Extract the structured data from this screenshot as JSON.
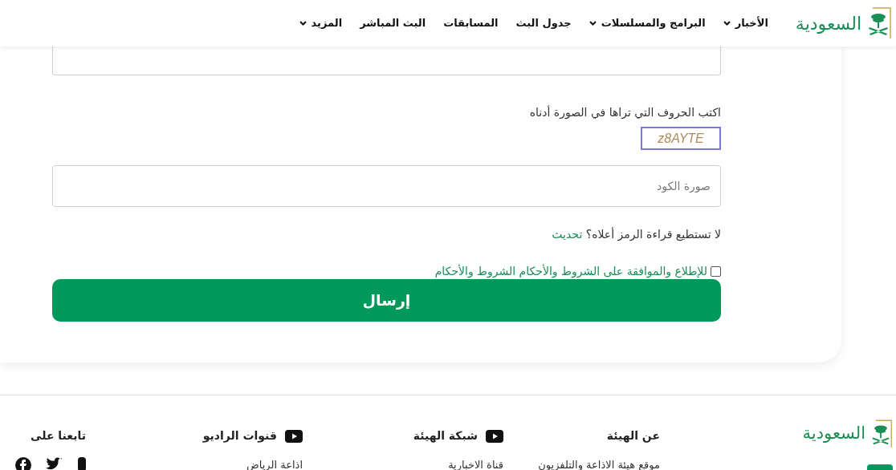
{
  "header": {
    "logo_text": "السعودية",
    "nav": [
      {
        "label": "الأخبار",
        "has_dropdown": true
      },
      {
        "label": "البرامج والمسلسلات",
        "has_dropdown": true
      },
      {
        "label": "جدول البث",
        "has_dropdown": false
      },
      {
        "label": "المسابقات",
        "has_dropdown": false
      },
      {
        "label": "البث المباشر",
        "has_dropdown": false
      },
      {
        "label": "المزيد",
        "has_dropdown": true
      }
    ]
  },
  "form": {
    "captcha_label": "اكتب الحروف التي تراها في الصورة أدناه",
    "captcha_text": "z8AYTE",
    "code_field": {
      "placeholder": "صورة الكود"
    },
    "refresh_prompt": "لا تستطيع قراءة الرمز أعلاه؟",
    "refresh_link": "تحديث",
    "terms": {
      "label": "للإطلاع والموافقة على الشروط والأحكام الشروط والأحكام",
      "checked": false
    },
    "submit": "إرسال"
  },
  "footer": {
    "logo_text": "السعودية",
    "columns": [
      {
        "title": "عن الهيئة",
        "has_icon": false,
        "links": [
          "موقع هيئة الاذاعة والتلفزيون"
        ]
      },
      {
        "title": "شبكة الهيئة",
        "has_icon": true,
        "links": [
          "قناة الاخبارية"
        ]
      },
      {
        "title": "قنوات الراديو",
        "has_icon": true,
        "links": [
          "اذاعة الرياض"
        ]
      }
    ],
    "follow_title": "تابعنا على"
  }
}
